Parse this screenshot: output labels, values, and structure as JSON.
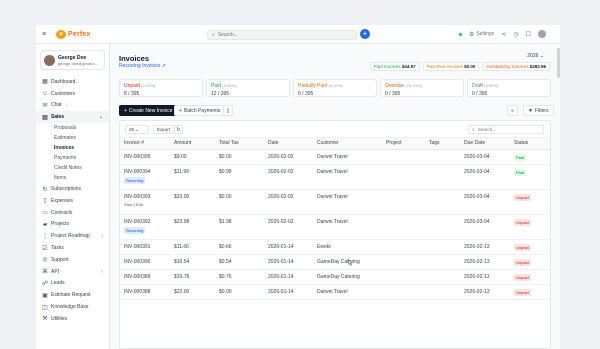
{
  "topbar": {
    "logo_text": "Perfex",
    "search_placeholder": "Search...",
    "settings_label": "Settings"
  },
  "user": {
    "name": "George Doe",
    "email": "george.doe@gmail.c..."
  },
  "sidebar": {
    "items": [
      {
        "label": "Dashboard",
        "icon": "dashboard-icon"
      },
      {
        "label": "Customers",
        "icon": "users-icon"
      },
      {
        "label": "Chat",
        "icon": "chat-icon",
        "badge": "↓"
      },
      {
        "label": "Sales",
        "icon": "receipt-icon",
        "expanded": true
      }
    ],
    "sales_sub": [
      "Proposals",
      "Estimates",
      "Invoices",
      "Payments",
      "Credit Notes",
      "Items"
    ],
    "items_after": [
      {
        "label": "Subscriptions",
        "icon": "refresh-icon"
      },
      {
        "label": "Expenses",
        "icon": "file-icon"
      },
      {
        "label": "Contracts",
        "icon": "contract-icon"
      },
      {
        "label": "Projects",
        "icon": "folder-icon"
      },
      {
        "label": "Project Roadmap",
        "icon": "roadmap-icon",
        "chev": "‹"
      },
      {
        "label": "Tasks",
        "icon": "check-icon"
      },
      {
        "label": "Support",
        "icon": "support-icon"
      },
      {
        "label": "API",
        "icon": "api-icon",
        "chev": "‹"
      },
      {
        "label": "Leads",
        "icon": "leads-icon"
      },
      {
        "label": "Estimate Request",
        "icon": "request-icon"
      },
      {
        "label": "Knowledge Base",
        "icon": "book-icon"
      },
      {
        "label": "Utilities",
        "icon": "tools-icon"
      }
    ]
  },
  "page": {
    "title": "Invoices",
    "recurring_link": "Recurring Invoices ➚",
    "year": "2026",
    "totals": [
      {
        "label": "Paid Invoices",
        "value": "$44.97",
        "color": "#16a34a"
      },
      {
        "label": "Past Due Invoices",
        "value": "$0.00",
        "color": "#d97706"
      },
      {
        "label": "Outstanding Invoices",
        "value": "$282.96",
        "color": "#ea580c"
      }
    ]
  },
  "stats": [
    {
      "label": "Unpaid",
      "pct": "(2.03%)",
      "value": "8 / 395",
      "color": "#dc2626"
    },
    {
      "label": "Paid",
      "pct": "(3.04%)",
      "value": "12 / 395",
      "color": "#16a34a"
    },
    {
      "label": "Partially Paid",
      "pct": "(0.00%)",
      "value": "0 / 395",
      "color": "#d97706"
    },
    {
      "label": "Overdue",
      "pct": "(78.23%)",
      "value": "0 / 395",
      "color": "#ea580c"
    },
    {
      "label": "Draft",
      "pct": "(0.00%)",
      "value": "0 / 395",
      "color": "#6b7280"
    }
  ],
  "actions": {
    "create": "Create New Invoice",
    "batch": "Batch Payments",
    "filters": "Filters"
  },
  "table_toolbar": {
    "per_page": "25",
    "export": "Export",
    "search_placeholder": "Search..."
  },
  "table": {
    "columns": [
      "Invoice #",
      "Amount",
      "Total Tax",
      "Date",
      "Customer",
      "Project",
      "Tags",
      "Due Date",
      "Status"
    ],
    "rows": [
      {
        "num": "INV-000395",
        "amount": "$9.00",
        "tax": "$0.00",
        "date": "2026-02-02",
        "customer": "Darwin Travel",
        "due": "2026-03-04",
        "status": "Paid",
        "recurring": false,
        "actions": false
      },
      {
        "num": "INV-000394",
        "amount": "$11.99",
        "tax": "$0.99",
        "date": "2026-02-02",
        "customer": "Darwin Travel",
        "due": "2026-03-04",
        "status": "Paid",
        "recurring": true,
        "actions": false
      },
      {
        "num": "INV-000393",
        "amount": "$33.00",
        "tax": "$0.00",
        "date": "2026-02-02",
        "customer": "Darwin Travel",
        "due": "2026-03-04",
        "status": "Unpaid",
        "recurring": false,
        "actions": true
      },
      {
        "num": "INV-000392",
        "amount": "$23.98",
        "tax": "$1.98",
        "date": "2026-02-02",
        "customer": "Darwin Travel",
        "due": "2026-03-04",
        "status": "Unpaid",
        "recurring": true,
        "actions": false
      },
      {
        "num": "INV-000391",
        "amount": "$11.66",
        "tax": "$0.66",
        "date": "2026-01-14",
        "customer": "Ewebi",
        "due": "2026-02-13",
        "status": "Unpaid",
        "recurring": false,
        "actions": false
      },
      {
        "num": "INV-000390",
        "amount": "$10.54",
        "tax": "$0.54",
        "date": "2026-01-14",
        "customer": "GameDay Catering",
        "due": "2026-02-13",
        "status": "Unpaid",
        "recurring": false,
        "actions": false
      },
      {
        "num": "INV-000389",
        "amount": "$19.76",
        "tax": "$0.76",
        "date": "2026-01-14",
        "customer": "GameDay Catering",
        "due": "2026-02-13",
        "status": "Unpaid",
        "recurring": false,
        "actions": false
      },
      {
        "num": "INV-000388",
        "amount": "$22.00",
        "tax": "$0.00",
        "date": "2026-01-14",
        "customer": "Darwin Travel",
        "due": "2026-02-13",
        "status": "Unpaid",
        "recurring": false,
        "actions": false
      }
    ],
    "recurring_label": "Recurring",
    "row_actions": "View | Edit"
  }
}
